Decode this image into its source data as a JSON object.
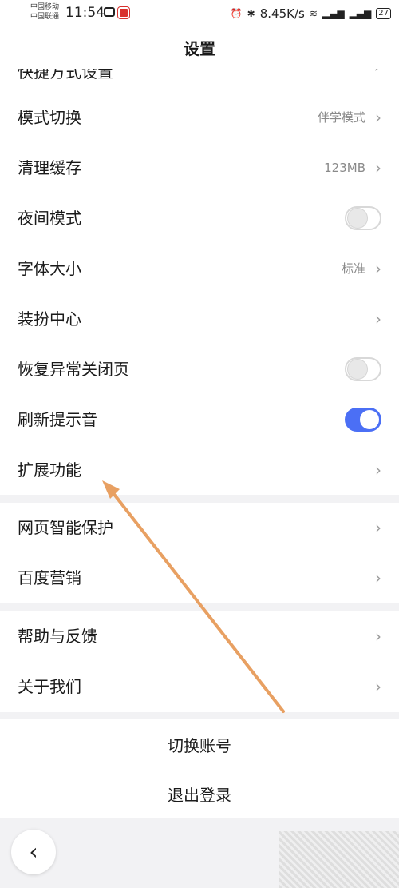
{
  "status_bar": {
    "carrier1": "中国移动",
    "carrier2": "中国联通",
    "time": "11:54",
    "speed": "8.45K/s",
    "battery": "27"
  },
  "header": {
    "title": "设置"
  },
  "partial_row": {
    "label": "快捷方式设置"
  },
  "settings": [
    {
      "label": "模式切换",
      "value": "伴学模式"
    },
    {
      "label": "清理缓存",
      "value": "123MB"
    },
    {
      "label": "夜间模式"
    },
    {
      "label": "字体大小",
      "value": "标准"
    },
    {
      "label": "装扮中心"
    },
    {
      "label": "恢复异常关闭页"
    },
    {
      "label": "刷新提示音"
    },
    {
      "label": "扩展功能"
    }
  ],
  "toggles": {
    "night_mode": false,
    "restore_pages": false,
    "refresh_sound": true
  },
  "section2": [
    {
      "label": "网页智能保护"
    },
    {
      "label": "百度营销"
    }
  ],
  "section3": [
    {
      "label": "帮助与反馈"
    },
    {
      "label": "关于我们"
    }
  ],
  "actions": {
    "switch_account": "切换账号",
    "logout": "退出登录"
  },
  "colors": {
    "accent": "#4b6ff5",
    "annotation_arrow": "#e8a062"
  },
  "icons": {
    "back": "chevron-left-icon",
    "chevron": "chevron-right-icon"
  }
}
